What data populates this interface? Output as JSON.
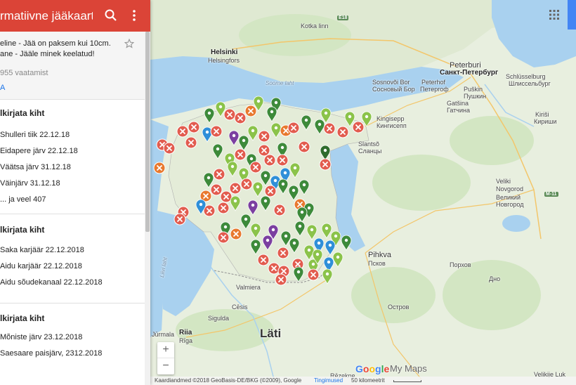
{
  "colors": {
    "header": "#db4437",
    "water": "#a9d1ef",
    "land": "#e8efdf",
    "forest": "#cfe3bf",
    "marker_green_dark": "#3d8a3a",
    "marker_green_light": "#8bc34a",
    "marker_red": "#e25c4f",
    "marker_orange": "#e8792f",
    "marker_blue": "#2f8fd8",
    "marker_purple": "#7b3fa0",
    "link": "#1a73e8"
  },
  "header": {
    "title": "rmatiivne jääkaart ...",
    "search_icon": "search-icon",
    "more_icon": "more-vert-icon"
  },
  "description": {
    "line1": "eline - Jää on paksem kui 10cm.",
    "line2": "ane - Jääle minek keelatud!",
    "views": "955 vaatamist",
    "share": "A",
    "star_icon": "star-outline-icon"
  },
  "layers": [
    {
      "title": "lkirjata kiht",
      "items": [
        "Shulleri tiik 22.12.18",
        "Eidapere järv 22.12.18",
        "Väätsa järv 31.12.18",
        "Väinjärv 31.12.18",
        "... ja veel 407"
      ]
    },
    {
      "title": "lkirjata kiht",
      "items": [
        "Saka karjäär 22.12.2018",
        "Aidu karjäär 22.12.2018",
        "Aidu sõudekanaal 22.12.2018"
      ]
    },
    {
      "title": "lkirjata kiht",
      "items": [
        "Mõniste järv 23.12.2018",
        "Saesaare paisjärv, 2312.2018"
      ]
    }
  ],
  "map": {
    "labels": {
      "helsinki": "Helsinki",
      "helsingfors": "Helsingfors",
      "kotka": "Kotka linn",
      "kotka2": "Kotka",
      "peterburi": "Peterburi",
      "spb": "Санкт-Петербург",
      "schlusselburg": "Schlüsselburg",
      "schlusselburg_ru": "Шлиссельбург",
      "sosnovy": "Sosnovõi Bor",
      "sosnovy_ru": "Сосновый Бор",
      "peterhof": "Peterhof",
      "peterhof_ru": "Петергоф",
      "pushkin": "Puškin",
      "pushkin_ru": "Пушкин",
      "gatchina": "Gatšina",
      "gatchina_ru": "Гатчина",
      "kirishi": "Kiriši",
      "kirishi_ru": "Кириши",
      "kingisepp": "Kingisepp",
      "kingisepp_ru": "Кингисепп",
      "slantsy": "Slantsõ",
      "slantsy_ru": "Сланцы",
      "novgorod": "Veliki",
      "novgorod2": "Novgorod",
      "novgorod_ru": "Великий",
      "novgorod_ru2": "Новгород",
      "pihkva": "Pihkva",
      "pihkva_ru": "Псков",
      "soome_laht": "Soome laht",
      "liivi_laht": "Liivi laht",
      "valmiera": "Valmiera",
      "cesis": "Cēsis",
      "sigulda": "Sigulda",
      "riia": "Riia",
      "riga": "Rīga",
      "jurmala": "Jūrmala",
      "lati": "Läti",
      "ostrov": "Остров",
      "porkhov": "Порхов",
      "dno": "Дно",
      "velikie_luki": "Velikije Luk",
      "rezekne": "Rēzekne",
      "e18": "E18",
      "m11": "M-11"
    },
    "controls": {
      "apps_icon": "apps-grid-icon",
      "zoom_in": "+",
      "zoom_out": "−"
    },
    "logo": {
      "g1": "G",
      "o1": "o",
      "o2": "o",
      "g2": "g",
      "l": "l",
      "e": "e",
      "mymaps": "My Maps"
    },
    "footer": {
      "attribution": "Kaardiandmed ©2018 GeoBasis-DE/BKG (©2009), Google",
      "terms": "Tingimused",
      "scale": "50 kilomeetrit"
    }
  }
}
